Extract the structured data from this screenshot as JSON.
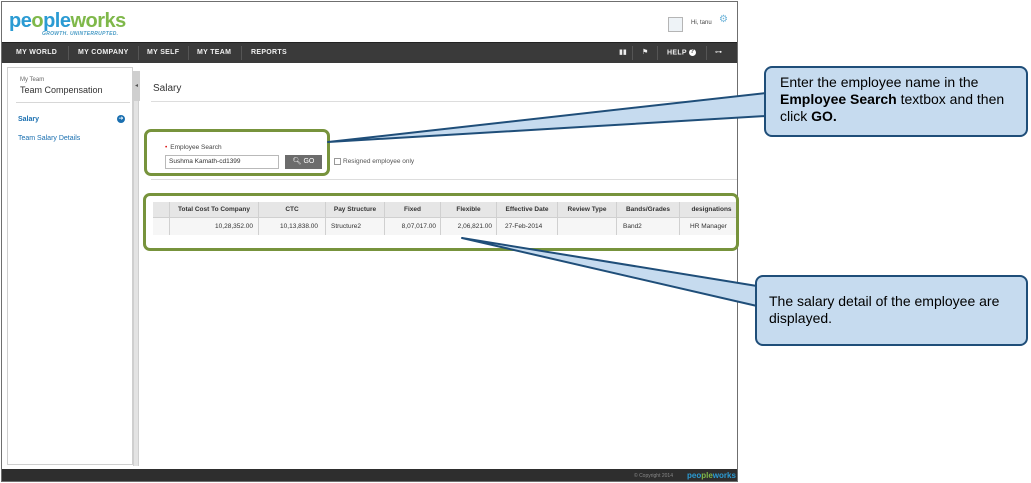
{
  "app": {
    "logo": {
      "pe": "pe",
      "o": "o",
      "ple": "ple",
      "w": "w",
      "o2": "o",
      "rks": "rks"
    },
    "tagline": "GROWTH. UNINTERRUPTED.",
    "greeting": "Hi, tanu"
  },
  "nav": {
    "items": [
      "MY WORLD",
      "MY COMPANY",
      "MY SELF",
      "MY TEAM",
      "REPORTS"
    ],
    "help": "HELP"
  },
  "sidebar": {
    "small": "My Team",
    "title": "Team Compensation",
    "salary": "Salary",
    "team_salary": "Team Salary Details"
  },
  "main": {
    "title": "Salary",
    "search_label": "Employee Search",
    "search_value": "Sushma Kamath-cd1399",
    "go": "GO",
    "resigned": "Resigned employee only"
  },
  "table": {
    "headers": [
      "",
      "Total Cost To Company",
      "CTC",
      "Pay Structure",
      "Fixed",
      "Flexible",
      "Effective Date",
      "Review Type",
      "Bands/Grades",
      "designations"
    ],
    "row": [
      "",
      "10,28,352.00",
      "10,13,838.00",
      "Structure2",
      "8,07,017.00",
      "2,06,821.00",
      "27-Feb-2014",
      "",
      "Band2",
      "HR Manager"
    ]
  },
  "footer": {
    "copyright": "© Copyright 2014",
    "logo_a": "peo",
    "logo_b": "ple",
    "logo_c": "works"
  },
  "callouts": {
    "one": {
      "pre": "Enter the employee name in the ",
      "bold1": "Employee Search",
      "mid": " textbox and then click ",
      "bold2": "GO."
    },
    "two": "The salary detail of the  employee are displayed."
  },
  "colors": {
    "highlight": "#77933c",
    "callout_fill": "#c6dbef",
    "callout_border": "#1f4e79",
    "nav": "#3a3a3a",
    "link": "#1a6fb0"
  }
}
